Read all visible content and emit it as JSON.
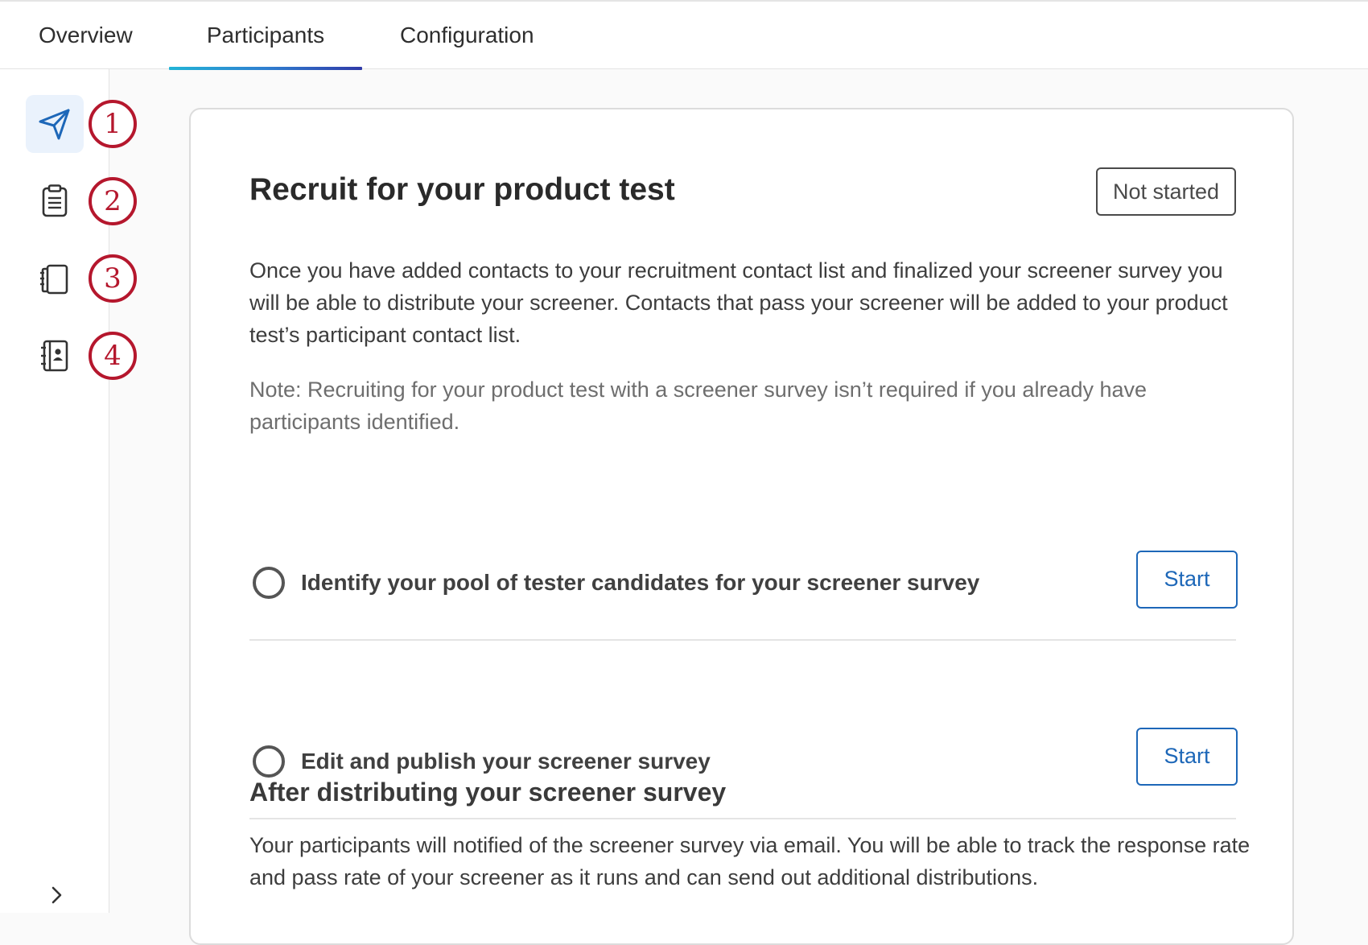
{
  "tabs": {
    "overview": "Overview",
    "participants": "Participants",
    "configuration": "Configuration",
    "active": "Participants"
  },
  "sidebar": {
    "items": [
      {
        "icon": "send-icon",
        "badge": "1",
        "active": true
      },
      {
        "icon": "clipboard-icon",
        "badge": "2",
        "active": false
      },
      {
        "icon": "pages-icon",
        "badge": "3",
        "active": false
      },
      {
        "icon": "contact-book-icon",
        "badge": "4",
        "active": false
      }
    ],
    "expand_icon": "chevron-right-icon"
  },
  "card": {
    "title": "Recruit for your product test",
    "status": "Not started",
    "description": "Once you have added contacts to your recruitment contact list and finalized your screener survey you will be able to distribute your screener. Contacts that pass your screener will be added to your product test’s participant contact list.",
    "note": "Note: Recruiting for your product test with a screener survey isn’t required if you already have participants identified.",
    "tasks": [
      {
        "label": "Identify your pool of tester candidates for your screener survey",
        "button": "Start"
      },
      {
        "label": "Edit and publish your screener survey",
        "button": "Start"
      }
    ],
    "after_title": "After distributing your screener survey",
    "after_text": "Your participants will notified of the screener survey via email. You will be able to track the response rate and pass rate of your screener as it runs and can send out additional distributions."
  },
  "colors": {
    "accent": "#1d67b8",
    "badge_red": "#b5172d",
    "active_bg": "#eaf2fc"
  }
}
